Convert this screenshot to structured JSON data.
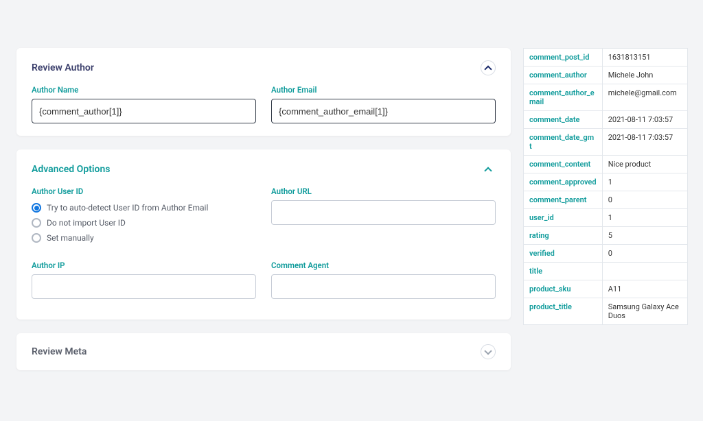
{
  "sections": {
    "review_author": {
      "title": "Review Author",
      "author_name_label": "Author Name",
      "author_name_value": "{comment_author[1]}",
      "author_email_label": "Author Email",
      "author_email_value": "{comment_author_email[1]}"
    },
    "advanced": {
      "title": "Advanced Options",
      "user_id_label": "Author User ID",
      "radios": [
        "Try to auto-detect User ID from Author Email",
        "Do not import User ID",
        "Set manually"
      ],
      "author_url_label": "Author URL",
      "author_url_value": "",
      "author_ip_label": "Author IP",
      "author_ip_value": "",
      "comment_agent_label": "Comment Agent",
      "comment_agent_value": ""
    },
    "review_meta": {
      "title": "Review Meta"
    }
  },
  "meta_table": [
    {
      "key": "comment_post_id",
      "val": "1631813151"
    },
    {
      "key": "comment_author",
      "val": "Michele John"
    },
    {
      "key": "comment_author_email",
      "val": "michele@gmail.com"
    },
    {
      "key": "comment_date",
      "val": "2021-08-11 7:03:57"
    },
    {
      "key": "comment_date_gmt",
      "val": "2021-08-11 7:03:57"
    },
    {
      "key": "comment_content",
      "val": "Nice product"
    },
    {
      "key": "comment_approved",
      "val": "1"
    },
    {
      "key": "comment_parent",
      "val": "0"
    },
    {
      "key": "user_id",
      "val": "1"
    },
    {
      "key": "rating",
      "val": "5"
    },
    {
      "key": "verified",
      "val": "0"
    },
    {
      "key": "title",
      "val": ""
    },
    {
      "key": "product_sku",
      "val": "A11"
    },
    {
      "key": "product_title",
      "val": "Samsung Galaxy Ace Duos"
    }
  ]
}
